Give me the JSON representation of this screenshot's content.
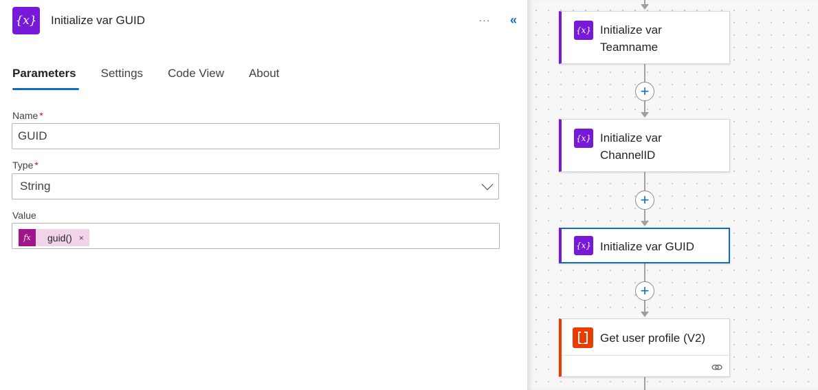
{
  "panel": {
    "icon_name": "variable-icon",
    "icon_glyph": "{x}",
    "title": "Initialize var GUID",
    "more_label": "···",
    "collapse_label": "«",
    "tabs": [
      {
        "label": "Parameters",
        "active": true
      },
      {
        "label": "Settings",
        "active": false
      },
      {
        "label": "Code View",
        "active": false
      },
      {
        "label": "About",
        "active": false
      }
    ],
    "fields": {
      "name": {
        "label": "Name",
        "required_mark": "*",
        "value": "GUID"
      },
      "type": {
        "label": "Type",
        "required_mark": "*",
        "value": "String"
      },
      "value": {
        "label": "Value",
        "token_icon": "fx",
        "token_text": "guid()",
        "token_remove": "×"
      }
    }
  },
  "canvas": {
    "cards": [
      {
        "title_line1": "Initialize var",
        "title_line2": "Teamname",
        "icon_glyph": "{x}"
      },
      {
        "title_line1": "Initialize var",
        "title_line2": "ChannelID",
        "icon_glyph": "{x}"
      },
      {
        "title": "Initialize var GUID",
        "icon_glyph": "{x}",
        "selected": true
      },
      {
        "title": "Get user profile (V2)",
        "icon_name": "office365-icon"
      }
    ],
    "plus_label": "+"
  },
  "colors": {
    "variable": "#7719d9",
    "office": "#eb3c00",
    "accent": "#0f6cbd",
    "expression": "#a1148b"
  }
}
